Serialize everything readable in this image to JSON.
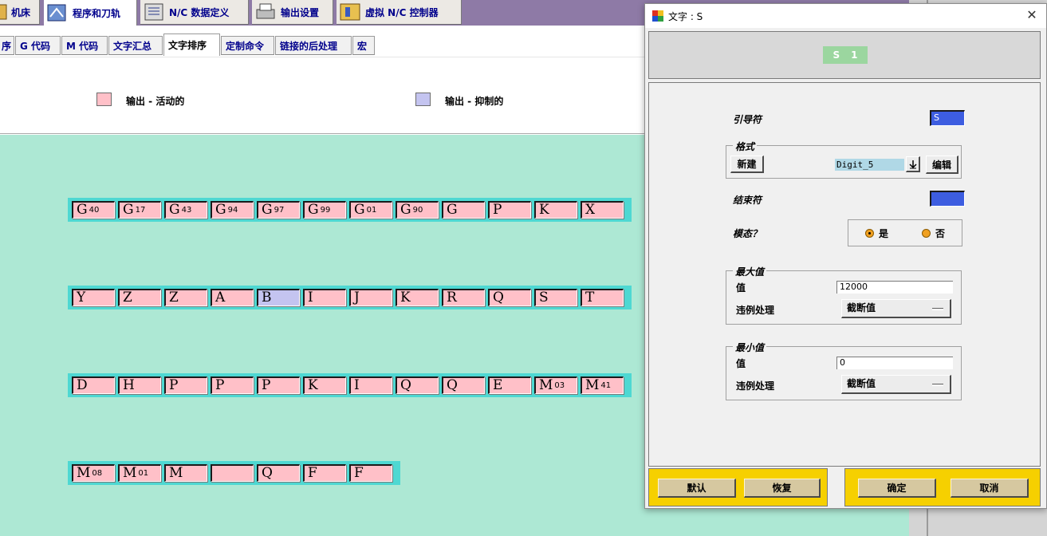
{
  "top_tabs": [
    {
      "label": "机床",
      "icon": "machine-icon"
    },
    {
      "label": "程序和刀轨",
      "icon": "program-icon"
    },
    {
      "label": "N/C 数据定义",
      "icon": "data-definition-icon"
    },
    {
      "label": "输出设置",
      "icon": "printer-icon"
    },
    {
      "label": "虚拟 N/C 控制器",
      "icon": "controller-icon"
    }
  ],
  "sub_tabs": [
    {
      "label": "序"
    },
    {
      "label": "G 代码"
    },
    {
      "label": "M 代码"
    },
    {
      "label": "文字汇总"
    },
    {
      "label": "文字排序"
    },
    {
      "label": "定制命令"
    },
    {
      "label": "链接的后处理"
    },
    {
      "label": "宏"
    }
  ],
  "legend": {
    "active_label": "输出 - 活动的",
    "suppressed_label": "输出 - 抑制的",
    "active_color": "#ffc0c8",
    "suppressed_color": "#c4c4f0"
  },
  "word_rows": [
    [
      {
        "main": "G",
        "sub": "40"
      },
      {
        "main": "G",
        "sub": "17"
      },
      {
        "main": "G",
        "sub": "43"
      },
      {
        "main": "G",
        "sub": "94"
      },
      {
        "main": "G",
        "sub": "97"
      },
      {
        "main": "G",
        "sub": "99"
      },
      {
        "main": "G",
        "sub": "01"
      },
      {
        "main": "G",
        "sub": "90"
      },
      {
        "main": "G",
        "sub": ""
      },
      {
        "main": "P",
        "sub": ""
      },
      {
        "main": "K",
        "sub": ""
      },
      {
        "main": "X",
        "sub": ""
      }
    ],
    [
      {
        "main": "Y",
        "sub": ""
      },
      {
        "main": "Z",
        "sub": ""
      },
      {
        "main": "Z",
        "sub": ""
      },
      {
        "main": "A",
        "sub": ""
      },
      {
        "main": "B",
        "sub": "",
        "suppressed": true
      },
      {
        "main": "I",
        "sub": ""
      },
      {
        "main": "J",
        "sub": ""
      },
      {
        "main": "K",
        "sub": ""
      },
      {
        "main": "R",
        "sub": ""
      },
      {
        "main": "Q",
        "sub": ""
      },
      {
        "main": "S",
        "sub": ""
      },
      {
        "main": "T",
        "sub": ""
      }
    ],
    [
      {
        "main": "D",
        "sub": ""
      },
      {
        "main": "H",
        "sub": ""
      },
      {
        "main": "P",
        "sub": ""
      },
      {
        "main": "P",
        "sub": ""
      },
      {
        "main": "P",
        "sub": ""
      },
      {
        "main": "K",
        "sub": ""
      },
      {
        "main": "I",
        "sub": ""
      },
      {
        "main": "Q",
        "sub": ""
      },
      {
        "main": "Q",
        "sub": ""
      },
      {
        "main": "E",
        "sub": ""
      },
      {
        "main": "M",
        "sub": "03"
      },
      {
        "main": "M",
        "sub": "41"
      }
    ],
    [
      {
        "main": "M",
        "sub": "08"
      },
      {
        "main": "M",
        "sub": "01"
      },
      {
        "main": "M",
        "sub": ""
      },
      {
        "main": "",
        "sub": ""
      },
      {
        "main": "Q",
        "sub": ""
      },
      {
        "main": "F",
        "sub": ""
      },
      {
        "main": "F",
        "sub": ""
      }
    ]
  ],
  "dialog": {
    "title": "文字 : S",
    "preview": {
      "letter": "S",
      "digit": "1"
    },
    "leader_label": "引导符",
    "leader_value": "S",
    "format": {
      "group_title": "格式",
      "new_button": "新建",
      "value": "Digit_5",
      "edit_button": "编辑"
    },
    "trailer_label": "结束符",
    "trailer_value": "",
    "modal": {
      "label": "模态？",
      "yes": "是",
      "no": "否",
      "selected": "是"
    },
    "max": {
      "group_title": "最大值",
      "value_label": "值",
      "value": "12000",
      "violation_label": "违例处理",
      "violation_value": "截断值"
    },
    "min": {
      "group_title": "最小值",
      "value_label": "值",
      "value": "0",
      "violation_label": "违例处理",
      "violation_value": "截断值"
    },
    "buttons": {
      "default": "默认",
      "restore": "恢复",
      "ok": "确定",
      "cancel": "取消"
    }
  }
}
